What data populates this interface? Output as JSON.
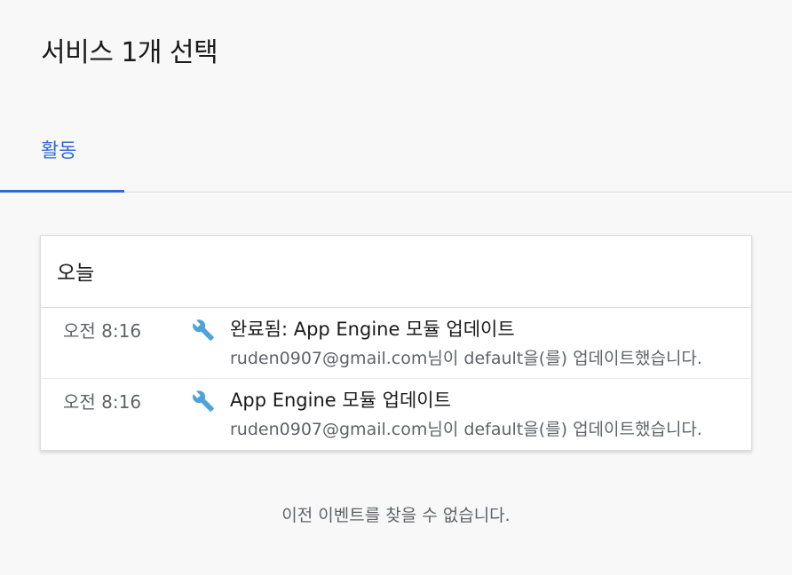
{
  "header": {
    "title": "서비스 1개 선택"
  },
  "tabs": [
    {
      "label": "활동",
      "active": true
    }
  ],
  "accent_color": "#3367d6",
  "icon_color": "#4fa3d8",
  "activity": {
    "section_title": "오늘",
    "items": [
      {
        "time": "오전 8:16",
        "icon": "wrench-icon",
        "title": "완료됨: App Engine 모듈 업데이트",
        "description": "ruden0907@gmail.com님이 default을(를) 업데이트했습니다."
      },
      {
        "time": "오전 8:16",
        "icon": "wrench-icon",
        "title": "App Engine 모듈 업데이트",
        "description": "ruden0907@gmail.com님이 default을(를) 업데이트했습니다."
      }
    ],
    "empty_message": "이전 이벤트를 찾을 수 없습니다."
  }
}
